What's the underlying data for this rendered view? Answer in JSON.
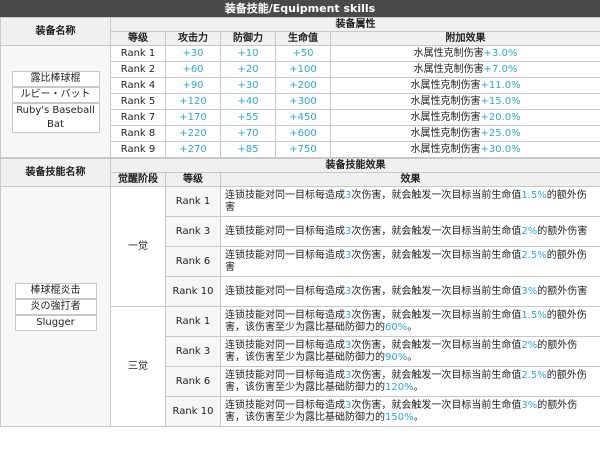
{
  "title": "装备技能/Equipment skills",
  "top": {
    "name_header": "装备名称",
    "attr_header": "装备属性",
    "col_headers": [
      "等级",
      "攻击力",
      "防御力",
      "生命值",
      "附加效果"
    ],
    "equip_names": [
      "露比棒球棍",
      "ルビー・バット",
      "Ruby's Baseball Bat"
    ],
    "rows": [
      {
        "rank": "Rank 1",
        "atk": "+30",
        "def": "+10",
        "hp": "+50",
        "effect_prefix": "水属性克制伤害",
        "effect_value": "+3.0%"
      },
      {
        "rank": "Rank 2",
        "atk": "+60",
        "def": "+20",
        "hp": "+100",
        "effect_prefix": "水属性克制伤害",
        "effect_value": "+7.0%"
      },
      {
        "rank": "Rank 4",
        "atk": "+90",
        "def": "+30",
        "hp": "+200",
        "effect_prefix": "水属性克制伤害",
        "effect_value": "+11.0%"
      },
      {
        "rank": "Rank 5",
        "atk": "+120",
        "def": "+40",
        "hp": "+300",
        "effect_prefix": "水属性克制伤害",
        "effect_value": "+15.0%"
      },
      {
        "rank": "Rank 7",
        "atk": "+170",
        "def": "+55",
        "hp": "+450",
        "effect_prefix": "水属性克制伤害",
        "effect_value": "+20.0%"
      },
      {
        "rank": "Rank 8",
        "atk": "+220",
        "def": "+70",
        "hp": "+600",
        "effect_prefix": "水属性克制伤害",
        "effect_value": "+25.0%"
      },
      {
        "rank": "Rank 9",
        "atk": "+270",
        "def": "+85",
        "hp": "+750",
        "effect_prefix": "水属性克制伤害",
        "effect_value": "+30.0%"
      }
    ]
  },
  "bottom": {
    "skill_name_header": "装备技能名称",
    "effect_header": "装备技能效果",
    "col_headers": [
      "觉醒阶段",
      "等级",
      "效果"
    ],
    "skill_names": [
      "棒球棍炎击",
      "炎の強打者",
      "Slugger"
    ],
    "stages": [
      {
        "label": "一觉",
        "rows": [
          {
            "rank": "Rank 1",
            "p1": "连锁技能对同一目标每造成",
            "hits": "3",
            "p2": "次伤害，就会触发一次目标当前生命值",
            "pct": "1.5%",
            "p3": "的额外伤害"
          },
          {
            "rank": "Rank 3",
            "p1": "连锁技能对同一目标每造成",
            "hits": "3",
            "p2": "次伤害，就会触发一次目标当前生命值",
            "pct": "2%",
            "p3": "的额外伤害"
          },
          {
            "rank": "Rank 6",
            "p1": "连锁技能对同一目标每造成",
            "hits": "3",
            "p2": "次伤害，就会触发一次目标当前生命值",
            "pct": "2.5%",
            "p3": "的额外伤害"
          },
          {
            "rank": "Rank 10",
            "p1": "连锁技能对同一目标每造成",
            "hits": "3",
            "p2": "次伤害，就会触发一次目标当前生命值",
            "pct": "3%",
            "p3": "的额外伤害"
          }
        ]
      },
      {
        "label": "三觉",
        "rows": [
          {
            "rank": "Rank 1",
            "p1": "连锁技能对同一目标每造成",
            "hits": "3",
            "p2": "次伤害，就会触发一次目标当前生命值",
            "pct": "1.5%",
            "p3": "的额外伤害，该伤害至少为露比基础防御力的",
            "floor": "60%",
            "p4": "。"
          },
          {
            "rank": "Rank 3",
            "p1": "连锁技能对同一目标每造成",
            "hits": "3",
            "p2": "次伤害，就会触发一次目标当前生命值",
            "pct": "2%",
            "p3": "的额外伤害，该伤害至少为露比基础防御力的",
            "floor": "90%",
            "p4": "。"
          },
          {
            "rank": "Rank 6",
            "p1": "连锁技能对同一目标每造成",
            "hits": "3",
            "p2": "次伤害，就会触发一次目标当前生命值",
            "pct": "2.5%",
            "p3": "的额外伤害，该伤害至少为露比基础防御力的",
            "floor": "120%",
            "p4": "。"
          },
          {
            "rank": "Rank 10",
            "p1": "连锁技能对同一目标每造成",
            "hits": "3",
            "p2": "次伤害，就会触发一次目标当前生命值",
            "pct": "3%",
            "p3": "的额外伤害，该伤害至少为露比基础防御力的",
            "floor": "150%",
            "p4": "。"
          }
        ]
      }
    ]
  }
}
